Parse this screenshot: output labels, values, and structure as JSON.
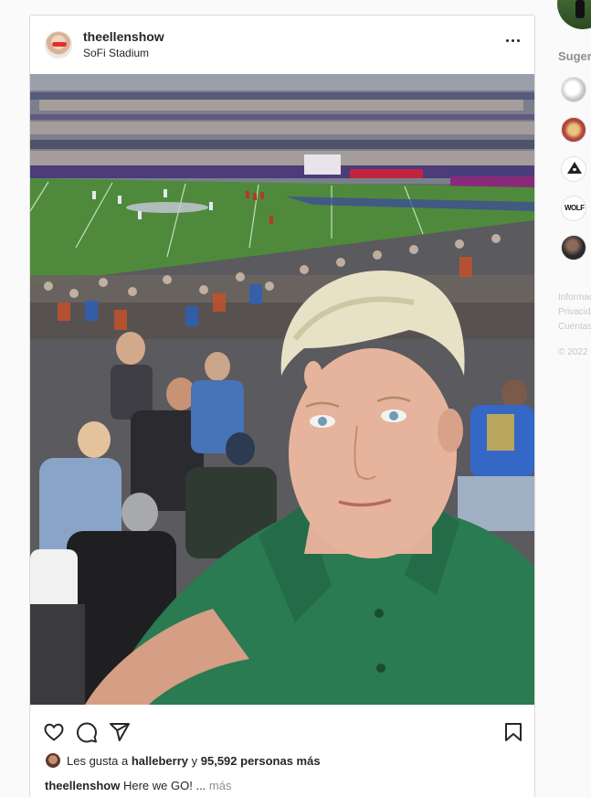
{
  "post": {
    "username": "theellenshow",
    "location": "SoFi Stadium",
    "photo_alt": "",
    "likes": {
      "prefix": "Les gusta a",
      "liker": "halleberry",
      "joiner": "y",
      "count_text": "95,592 personas más"
    },
    "caption": {
      "username": "theellenshow",
      "text": "Here we GO! ...",
      "more_label": "más"
    }
  },
  "sidebar": {
    "suggestions_title": "Sugerencias",
    "suggestion_3_logo": "",
    "suggestion_4_logo": "WOLF",
    "footer_links": [
      "Información",
      "Privacidad",
      "Cuentas"
    ],
    "copyright": "© 2022"
  },
  "icons": {
    "more": "more-horizontal-icon",
    "like": "heart-icon",
    "comment": "comment-icon",
    "share": "send-icon",
    "save": "bookmark-icon"
  },
  "colors": {
    "text": "#262626",
    "muted": "#8e8e8e",
    "border": "#dbdbdb",
    "shirt": "#2a7a52",
    "field": "#4f8a3c"
  }
}
